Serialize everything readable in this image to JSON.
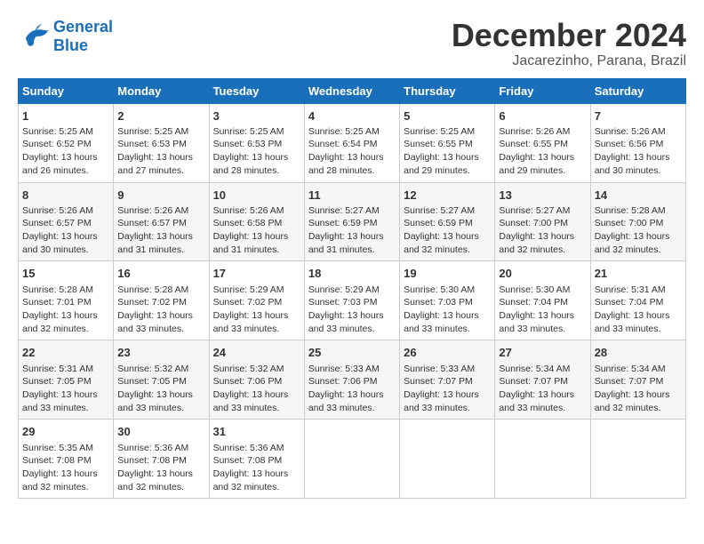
{
  "logo": {
    "line1": "General",
    "line2": "Blue"
  },
  "header": {
    "month": "December 2024",
    "location": "Jacarezinho, Parana, Brazil"
  },
  "weekdays": [
    "Sunday",
    "Monday",
    "Tuesday",
    "Wednesday",
    "Thursday",
    "Friday",
    "Saturday"
  ],
  "weeks": [
    [
      {
        "day": "1",
        "sunrise": "Sunrise: 5:25 AM",
        "sunset": "Sunset: 6:52 PM",
        "daylight": "Daylight: 13 hours and 26 minutes."
      },
      {
        "day": "2",
        "sunrise": "Sunrise: 5:25 AM",
        "sunset": "Sunset: 6:53 PM",
        "daylight": "Daylight: 13 hours and 27 minutes."
      },
      {
        "day": "3",
        "sunrise": "Sunrise: 5:25 AM",
        "sunset": "Sunset: 6:53 PM",
        "daylight": "Daylight: 13 hours and 28 minutes."
      },
      {
        "day": "4",
        "sunrise": "Sunrise: 5:25 AM",
        "sunset": "Sunset: 6:54 PM",
        "daylight": "Daylight: 13 hours and 28 minutes."
      },
      {
        "day": "5",
        "sunrise": "Sunrise: 5:25 AM",
        "sunset": "Sunset: 6:55 PM",
        "daylight": "Daylight: 13 hours and 29 minutes."
      },
      {
        "day": "6",
        "sunrise": "Sunrise: 5:26 AM",
        "sunset": "Sunset: 6:55 PM",
        "daylight": "Daylight: 13 hours and 29 minutes."
      },
      {
        "day": "7",
        "sunrise": "Sunrise: 5:26 AM",
        "sunset": "Sunset: 6:56 PM",
        "daylight": "Daylight: 13 hours and 30 minutes."
      }
    ],
    [
      {
        "day": "8",
        "sunrise": "Sunrise: 5:26 AM",
        "sunset": "Sunset: 6:57 PM",
        "daylight": "Daylight: 13 hours and 30 minutes."
      },
      {
        "day": "9",
        "sunrise": "Sunrise: 5:26 AM",
        "sunset": "Sunset: 6:57 PM",
        "daylight": "Daylight: 13 hours and 31 minutes."
      },
      {
        "day": "10",
        "sunrise": "Sunrise: 5:26 AM",
        "sunset": "Sunset: 6:58 PM",
        "daylight": "Daylight: 13 hours and 31 minutes."
      },
      {
        "day": "11",
        "sunrise": "Sunrise: 5:27 AM",
        "sunset": "Sunset: 6:59 PM",
        "daylight": "Daylight: 13 hours and 31 minutes."
      },
      {
        "day": "12",
        "sunrise": "Sunrise: 5:27 AM",
        "sunset": "Sunset: 6:59 PM",
        "daylight": "Daylight: 13 hours and 32 minutes."
      },
      {
        "day": "13",
        "sunrise": "Sunrise: 5:27 AM",
        "sunset": "Sunset: 7:00 PM",
        "daylight": "Daylight: 13 hours and 32 minutes."
      },
      {
        "day": "14",
        "sunrise": "Sunrise: 5:28 AM",
        "sunset": "Sunset: 7:00 PM",
        "daylight": "Daylight: 13 hours and 32 minutes."
      }
    ],
    [
      {
        "day": "15",
        "sunrise": "Sunrise: 5:28 AM",
        "sunset": "Sunset: 7:01 PM",
        "daylight": "Daylight: 13 hours and 32 minutes."
      },
      {
        "day": "16",
        "sunrise": "Sunrise: 5:28 AM",
        "sunset": "Sunset: 7:02 PM",
        "daylight": "Daylight: 13 hours and 33 minutes."
      },
      {
        "day": "17",
        "sunrise": "Sunrise: 5:29 AM",
        "sunset": "Sunset: 7:02 PM",
        "daylight": "Daylight: 13 hours and 33 minutes."
      },
      {
        "day": "18",
        "sunrise": "Sunrise: 5:29 AM",
        "sunset": "Sunset: 7:03 PM",
        "daylight": "Daylight: 13 hours and 33 minutes."
      },
      {
        "day": "19",
        "sunrise": "Sunrise: 5:30 AM",
        "sunset": "Sunset: 7:03 PM",
        "daylight": "Daylight: 13 hours and 33 minutes."
      },
      {
        "day": "20",
        "sunrise": "Sunrise: 5:30 AM",
        "sunset": "Sunset: 7:04 PM",
        "daylight": "Daylight: 13 hours and 33 minutes."
      },
      {
        "day": "21",
        "sunrise": "Sunrise: 5:31 AM",
        "sunset": "Sunset: 7:04 PM",
        "daylight": "Daylight: 13 hours and 33 minutes."
      }
    ],
    [
      {
        "day": "22",
        "sunrise": "Sunrise: 5:31 AM",
        "sunset": "Sunset: 7:05 PM",
        "daylight": "Daylight: 13 hours and 33 minutes."
      },
      {
        "day": "23",
        "sunrise": "Sunrise: 5:32 AM",
        "sunset": "Sunset: 7:05 PM",
        "daylight": "Daylight: 13 hours and 33 minutes."
      },
      {
        "day": "24",
        "sunrise": "Sunrise: 5:32 AM",
        "sunset": "Sunset: 7:06 PM",
        "daylight": "Daylight: 13 hours and 33 minutes."
      },
      {
        "day": "25",
        "sunrise": "Sunrise: 5:33 AM",
        "sunset": "Sunset: 7:06 PM",
        "daylight": "Daylight: 13 hours and 33 minutes."
      },
      {
        "day": "26",
        "sunrise": "Sunrise: 5:33 AM",
        "sunset": "Sunset: 7:07 PM",
        "daylight": "Daylight: 13 hours and 33 minutes."
      },
      {
        "day": "27",
        "sunrise": "Sunrise: 5:34 AM",
        "sunset": "Sunset: 7:07 PM",
        "daylight": "Daylight: 13 hours and 33 minutes."
      },
      {
        "day": "28",
        "sunrise": "Sunrise: 5:34 AM",
        "sunset": "Sunset: 7:07 PM",
        "daylight": "Daylight: 13 hours and 32 minutes."
      }
    ],
    [
      {
        "day": "29",
        "sunrise": "Sunrise: 5:35 AM",
        "sunset": "Sunset: 7:08 PM",
        "daylight": "Daylight: 13 hours and 32 minutes."
      },
      {
        "day": "30",
        "sunrise": "Sunrise: 5:36 AM",
        "sunset": "Sunset: 7:08 PM",
        "daylight": "Daylight: 13 hours and 32 minutes."
      },
      {
        "day": "31",
        "sunrise": "Sunrise: 5:36 AM",
        "sunset": "Sunset: 7:08 PM",
        "daylight": "Daylight: 13 hours and 32 minutes."
      },
      null,
      null,
      null,
      null
    ]
  ]
}
